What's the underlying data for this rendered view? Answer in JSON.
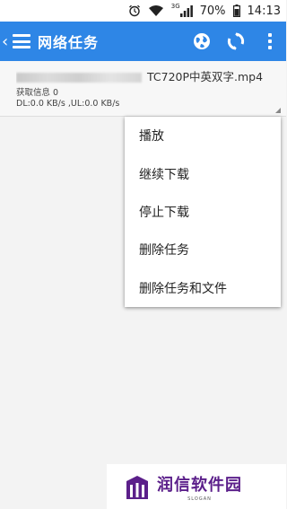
{
  "statusbar": {
    "network_badge": "3G",
    "battery": "70%",
    "time": "14:13",
    "icons": [
      "alarm-icon",
      "wifi-icon",
      "signal-icon",
      "battery-icon"
    ]
  },
  "appbar": {
    "title": "网络任务",
    "icons": [
      "back-icon",
      "menu-icon",
      "globe-icon",
      "refresh-icon",
      "more-icon"
    ],
    "color": "#2e86e6"
  },
  "task": {
    "filename_visible": "TC720P中英双字.mp4",
    "info": "获取信息  0",
    "speed": "DL:0.0 KB/s ,UL:0.0 KB/s"
  },
  "menu": {
    "items": [
      "播放",
      "继续下载",
      "停止下载",
      "删除任务",
      "删除任务和文件"
    ]
  },
  "watermark": {
    "text": "润信软件园",
    "slogan": "SLOGAN",
    "color": "#5b1f8a"
  }
}
